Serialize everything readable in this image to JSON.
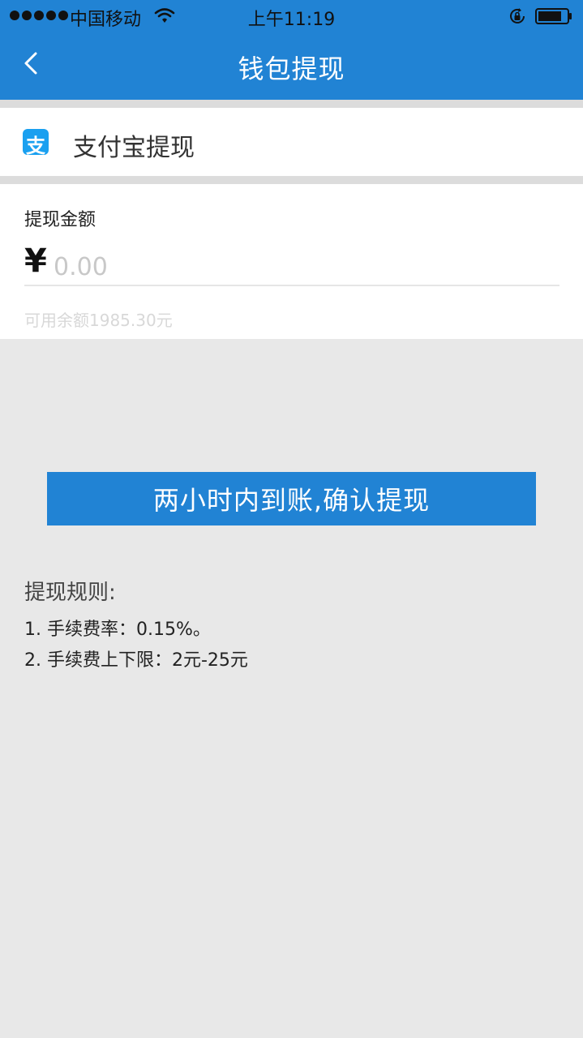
{
  "status_bar": {
    "carrier": "中国移动",
    "time": "上午11:19",
    "signal_icon": "signal-dots-icon",
    "wifi_icon": "wifi-icon",
    "rotation_lock_icon": "rotation-lock-icon",
    "battery_icon": "battery-icon"
  },
  "nav": {
    "title": "钱包提现",
    "back_icon": "chevron-left-icon"
  },
  "method": {
    "icon": "alipay-icon",
    "icon_glyph": "支",
    "label": "支付宝提现"
  },
  "amount": {
    "label": "提现金额",
    "currency": "¥",
    "value": "",
    "placeholder": "0.00",
    "balance": "可用余额1985.30元"
  },
  "confirm_button": {
    "label": "两小时内到账,确认提现"
  },
  "rules": {
    "title": "提现规则:",
    "items": [
      "1. 手续费率：0.15%。",
      "2. 手续费上下限：2元-25元"
    ]
  },
  "colors": {
    "primary": "#2183d4",
    "background": "#e8e8e8",
    "alipay": "#1aa0f0"
  }
}
